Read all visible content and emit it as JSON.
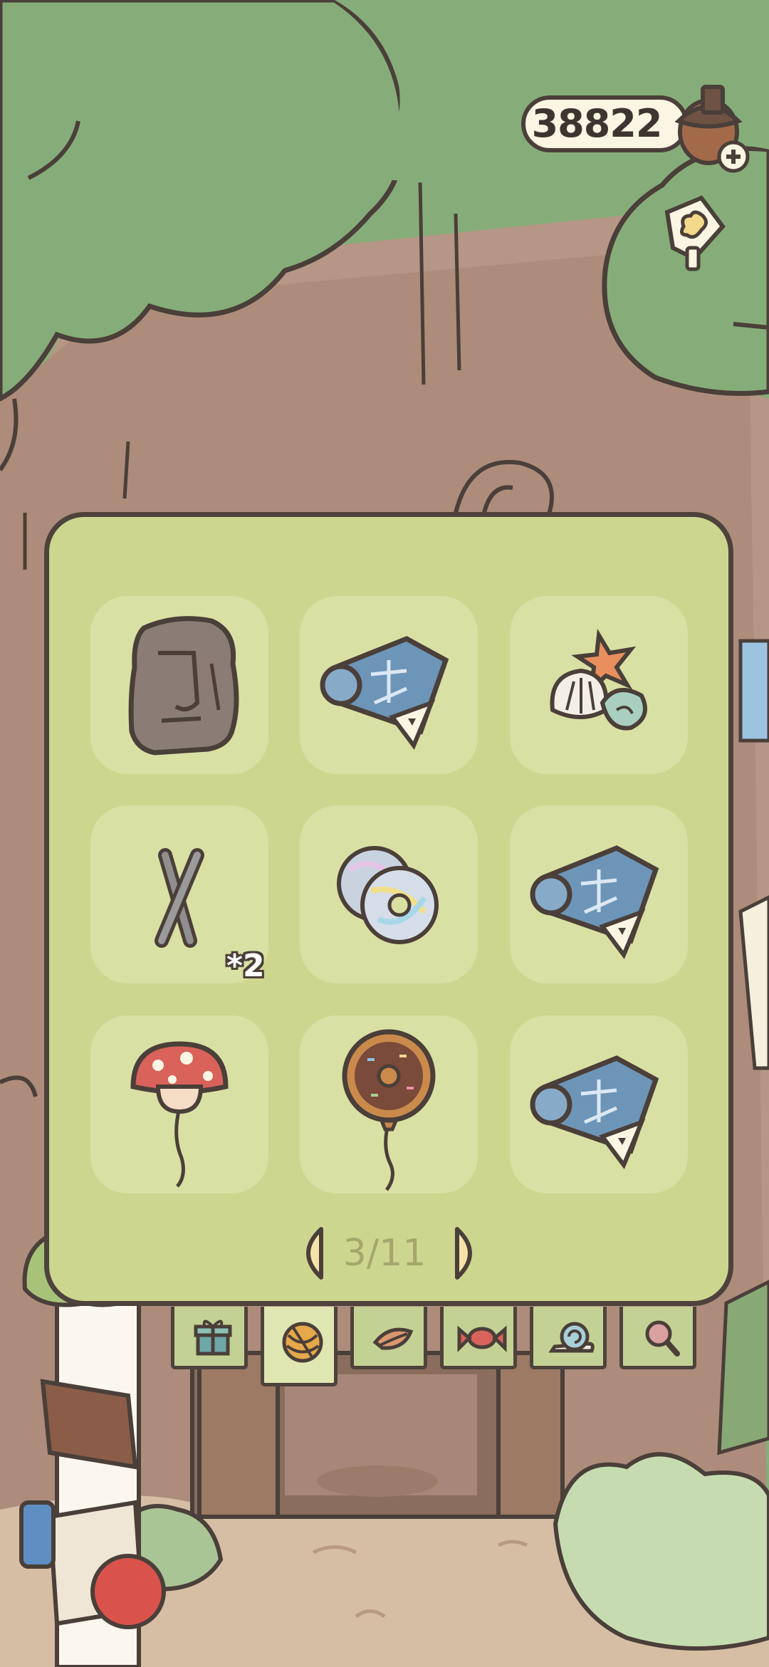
{
  "header": {
    "acorn_count": "38822",
    "currency_icon": "acorn-plus-icon",
    "sticker_icon": "clover-sticker-icon"
  },
  "inventory": {
    "slots": [
      {
        "item": "moai-statue",
        "qty": ""
      },
      {
        "item": "blueprint-scroll",
        "qty": ""
      },
      {
        "item": "seashells",
        "qty": ""
      },
      {
        "item": "iron-sticks",
        "qty": "*2"
      },
      {
        "item": "cd-discs",
        "qty": ""
      },
      {
        "item": "blueprint-scroll",
        "qty": ""
      },
      {
        "item": "mushroom-balloon",
        "qty": ""
      },
      {
        "item": "donut-balloon",
        "qty": ""
      },
      {
        "item": "blueprint-scroll",
        "qty": ""
      }
    ],
    "page": "3/11"
  },
  "tabs": [
    {
      "icon": "gift-icon",
      "active": false
    },
    {
      "icon": "yarn-icon",
      "active": true
    },
    {
      "icon": "leaf-icon",
      "active": false
    },
    {
      "icon": "candy-icon",
      "active": false
    },
    {
      "icon": "snail-icon",
      "active": false
    },
    {
      "icon": "magnifier-icon",
      "active": false
    }
  ],
  "colors": {
    "panel": "#cdd68f",
    "slot": "#d9e0a3",
    "outline": "#4d433c",
    "foliage": "#86ad79",
    "trunk": "#b69686"
  }
}
